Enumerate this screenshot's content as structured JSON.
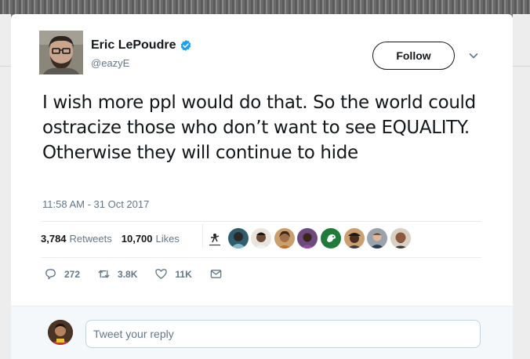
{
  "tweet": {
    "author_name": "Eric LePoudre",
    "handle": "@eazyE",
    "verified": true,
    "follow_label": "Follow",
    "text": "I wish more ppl would do that. So the world could ostracize those who don’t want to see EQUALITY. Otherwise they will continue to hide",
    "timestamp": "11:58 AM - 31 Oct 2017"
  },
  "stats": {
    "retweets_count": "3,784",
    "retweets_label": "Retweets",
    "likes_count": "10,700",
    "likes_label": "Likes"
  },
  "actions": {
    "reply_count": "272",
    "retweet_count": "3.8K",
    "like_count": "11K"
  },
  "reply": {
    "placeholder": "Tweet your reply"
  },
  "colors": {
    "text": "#14171a",
    "muted": "#657786",
    "verified": "#1da1f2",
    "divider": "#e6ecf0"
  },
  "icons": [
    "verified-badge-icon",
    "chevron-down-icon",
    "reply-icon",
    "retweet-icon",
    "like-icon",
    "direct-message-icon"
  ]
}
